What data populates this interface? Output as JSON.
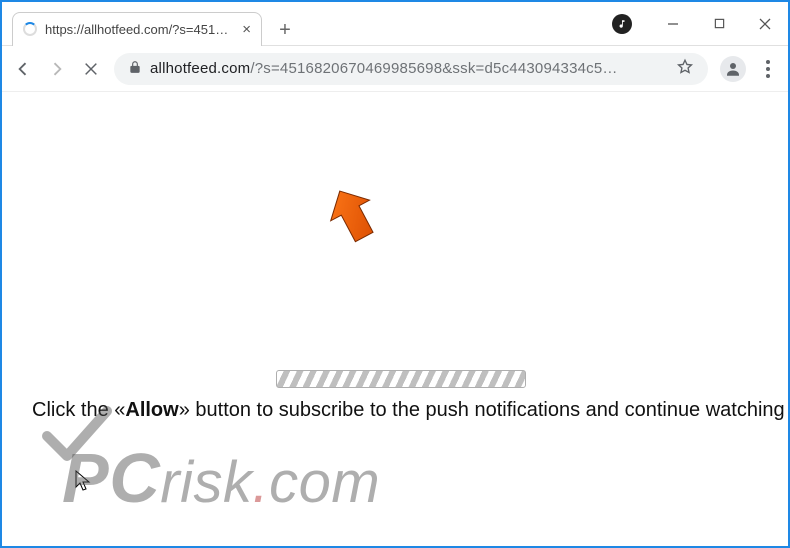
{
  "tab": {
    "title": "https://allhotfeed.com/?s=45168…"
  },
  "omnibox": {
    "domain": "allhotfeed.com",
    "path": "/?s=4516820670469985698&ssk=d5c443094334c5…"
  },
  "page": {
    "instruction_prefix": "Click the «",
    "instruction_bold": "Allow",
    "instruction_suffix": "» button to subscribe to the push notifications and continue watching"
  },
  "watermark": {
    "text": "PCrisk.com"
  },
  "icons": {
    "close_tab": "×",
    "new_tab": "+"
  }
}
